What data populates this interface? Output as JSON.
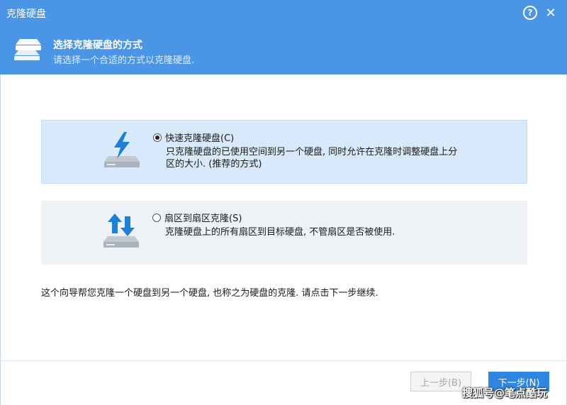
{
  "window": {
    "title": "克隆硬盘"
  },
  "header": {
    "title": "选择克隆硬盘的方式",
    "subtitle": "请选择一个合适的方式以克隆硬盘.",
    "icon": "disk-stack-icon"
  },
  "options": [
    {
      "label": "快速克隆硬盘(C)",
      "description": "只克隆硬盘的已使用空间到另一个硬盘, 同时允许在克隆时调整硬盘上分区的大小. (推荐的方式)",
      "selected": true,
      "icon": "lightning-disk-icon"
    },
    {
      "label": "扇区到扇区克隆(S)",
      "description": "克隆硬盘上的所有扇区到目标硬盘, 不管扇区是否被使用.",
      "selected": false,
      "icon": "arrows-disk-icon"
    }
  ],
  "wizard_text": "这个向导帮您克隆一个硬盘到另一个硬盘, 也称之为硬盘的克隆. 请点击下一步继续.",
  "buttons": {
    "prev": "上一步(B)",
    "next": "下一步(N)"
  },
  "watermark": "搜狐号@笔点酷玩",
  "colors": {
    "accent": "#4a95e6",
    "selected_bg": "#d7e9fa",
    "button_primary": "#2f86e0"
  }
}
